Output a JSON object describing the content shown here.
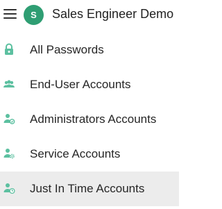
{
  "header": {
    "menu_icon": "hamburger-menu-icon",
    "avatar_initial": "S",
    "avatar_color": "#2f9e73",
    "org_name": "Sales Engineer Demo"
  },
  "nav": {
    "accent_color": "#5cc0a0",
    "active_background": "#ececec",
    "items": [
      {
        "label": "All Passwords",
        "icon": "lock-icon"
      },
      {
        "label": "End-User Accounts",
        "icon": "users-icon"
      },
      {
        "label": "Administrators Accounts",
        "icon": "admin-user-icon"
      },
      {
        "label": "Service Accounts",
        "icon": "service-account-icon"
      },
      {
        "label": "Just In Time Accounts",
        "icon": "jit-account-icon",
        "active": true
      }
    ]
  }
}
